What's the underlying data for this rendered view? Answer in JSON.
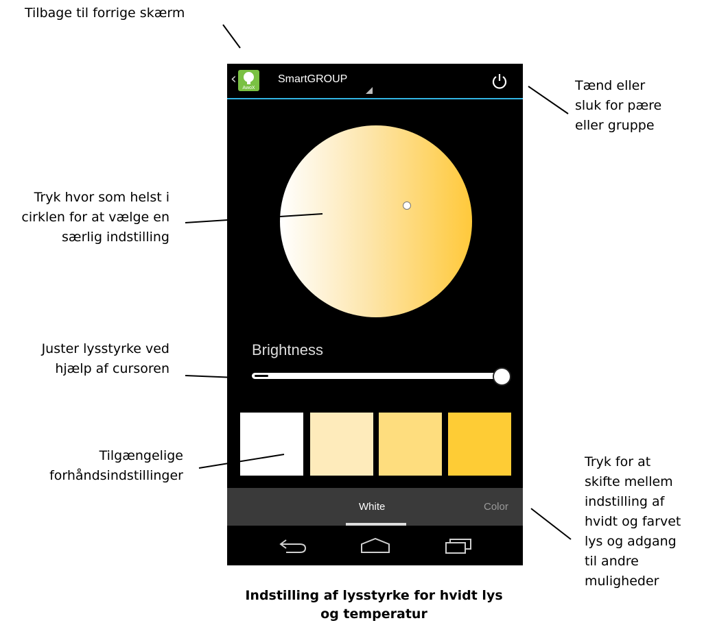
{
  "annotations": {
    "back": "Tilbage til forrige skærm",
    "power": "Tænd eller\nsluk for pære\neller gruppe",
    "circle": "Tryk hvor som helst i\ncirklen for at vælge en\nsærlig indstilling",
    "brightness": "Juster lysstyrke ved\nhjælp af cursoren",
    "presets": "Tilgængelige\nforhåndsindstillinger",
    "tabs": "Tryk for at\nskifte mellem\nindstilling af\nhvidt og farvet\nlys og adgang\ntil andre\nmuligheder"
  },
  "caption": "Indstilling af lysstyrke for hvidt lys\nog temperatur",
  "app": {
    "logo_text": "AwoX",
    "title": "SmartGROUP",
    "brightness_label": "Brightness",
    "brightness_value": 1.0,
    "tabs": [
      {
        "label": "White",
        "selected": true
      },
      {
        "label": "Color",
        "selected": false
      }
    ],
    "presets": [
      {
        "color": "#ffffff"
      },
      {
        "color": "#feebbb"
      },
      {
        "color": "#fedd7e"
      },
      {
        "color": "#fecc35"
      }
    ],
    "wheel_gradient": [
      "#ffffff",
      "#fde6ad",
      "#ffc93b"
    ],
    "accent_color": "#33b5e5",
    "icons": {
      "back": "chevron-left-icon",
      "power": "power-icon",
      "nav_back": "back-arrow-icon",
      "nav_home": "home-icon",
      "nav_recent": "recent-apps-icon"
    }
  }
}
